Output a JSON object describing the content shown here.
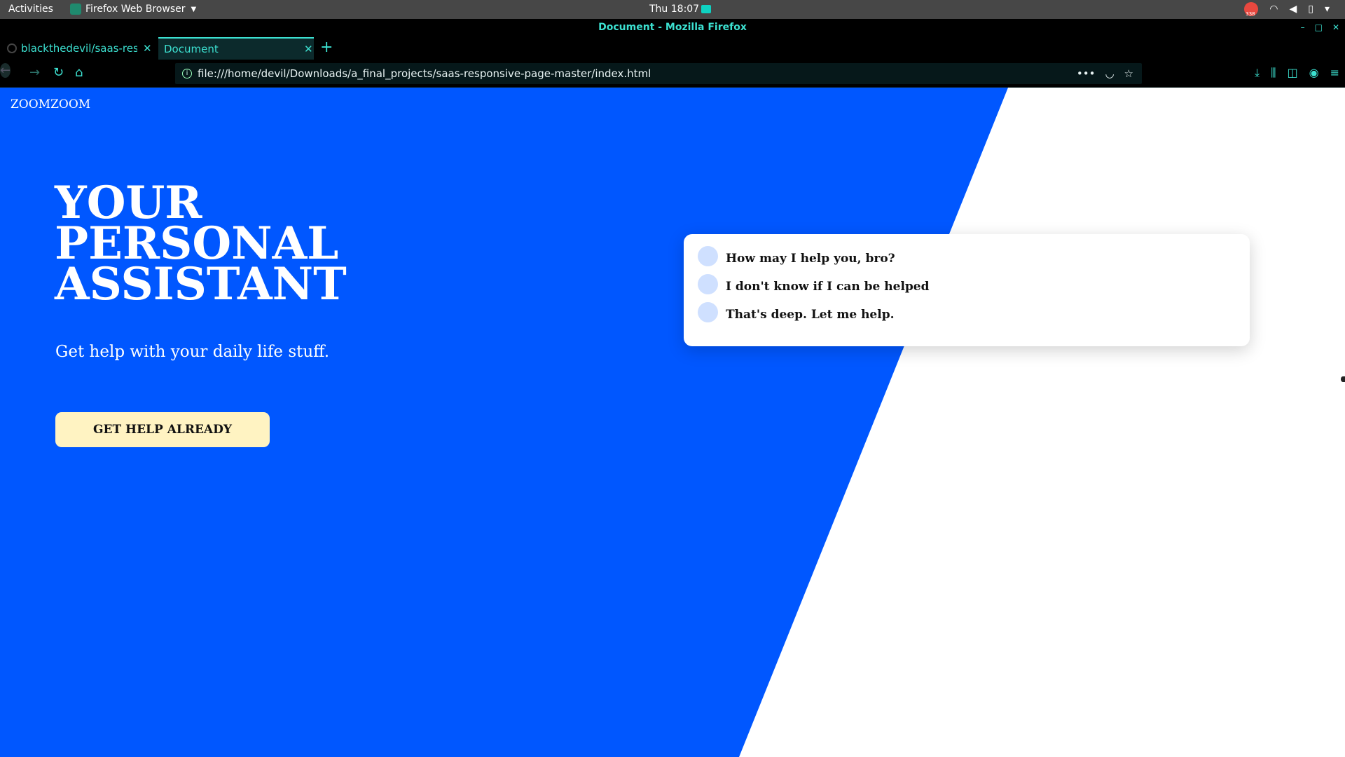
{
  "system_bar": {
    "activities": "Activities",
    "app_name": "Firefox Web Browser",
    "clock": "Thu 18:07",
    "badge_count": "338"
  },
  "window": {
    "title": "Document - Mozilla Firefox"
  },
  "tabs": [
    {
      "label": "blackthedevil/saas-responsive-page",
      "active": false
    },
    {
      "label": "Document",
      "active": true
    }
  ],
  "navbar": {
    "url": "file:///home/devil/Downloads/a_final_projects/saas-responsive-page-master/index.html"
  },
  "page": {
    "logo": "ZOOMZOOM",
    "headline": [
      "YOUR",
      "PERSONAL",
      "ASSISTANT"
    ],
    "subtitle": "Get help with your daily life stuff.",
    "cta_label": "GET HELP ALREADY",
    "chat_messages": [
      "How may I help you, bro?",
      "I don't know if I can be helped",
      "That's deep. Let me help."
    ]
  },
  "colors": {
    "hero_blue": "#0057ff",
    "cta_bg": "#fff3c2",
    "avatar": "#cfe0ff",
    "firefox_accent": "#3ce0d0",
    "chrome_bg": "#000000"
  },
  "icons": {
    "topbar": [
      "firefox-icon",
      "clock-notification-icon",
      "notification-badge-icon",
      "wifi-icon",
      "volume-icon",
      "battery-icon"
    ],
    "navbar": [
      "back-icon",
      "forward-icon",
      "reload-icon",
      "home-icon",
      "info-icon",
      "page-actions-icon",
      "pocket-icon",
      "bookmark-star-icon",
      "downloads-icon",
      "library-icon",
      "sidebar-icon",
      "account-icon",
      "menu-icon"
    ]
  }
}
